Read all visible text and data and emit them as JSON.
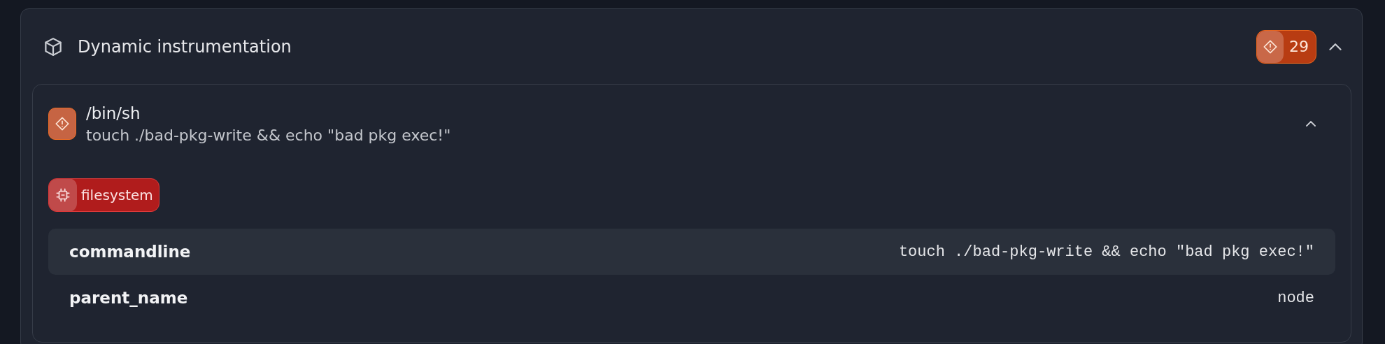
{
  "section": {
    "title": "Dynamic instrumentation",
    "count": "29",
    "expanded": true,
    "events": [
      {
        "process": "/bin/sh",
        "command": "touch ./bad-pkg-write && echo \"bad pkg exec!\"",
        "expanded": true,
        "tags": [
          {
            "label": "filesystem"
          }
        ],
        "properties": [
          {
            "key": "commandline",
            "value": "touch ./bad-pkg-write && echo \"bad pkg exec!\""
          },
          {
            "key": "parent_name",
            "value": "node"
          }
        ]
      }
    ]
  }
}
